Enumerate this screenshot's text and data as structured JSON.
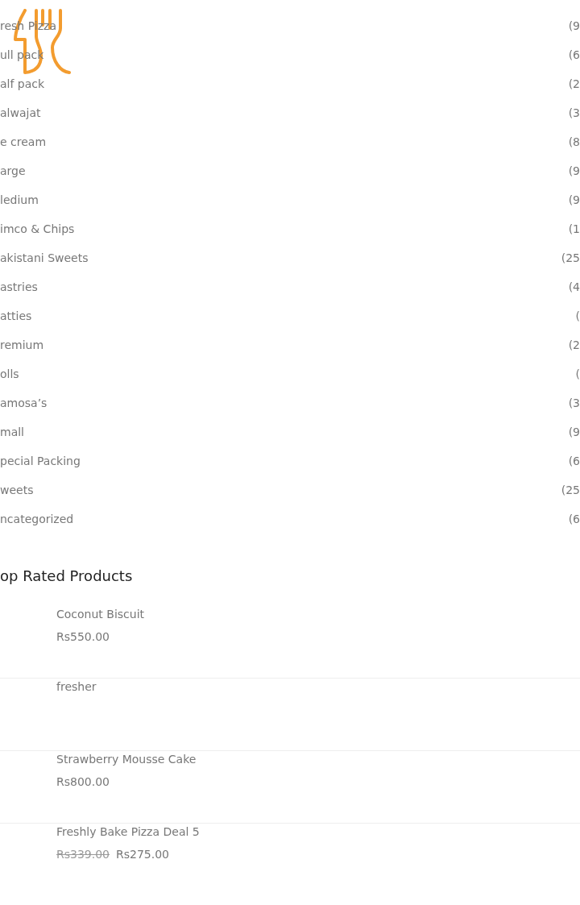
{
  "categories": [
    {
      "label": "resh Pizza",
      "count": "(9"
    },
    {
      "label": "ull pack",
      "count": "(6"
    },
    {
      "label": "alf pack",
      "count": "(2"
    },
    {
      "label": "alwajat",
      "count": "(3"
    },
    {
      "label": "e cream",
      "count": "(8"
    },
    {
      "label": "arge",
      "count": "(9"
    },
    {
      "label": "ledium",
      "count": "(9"
    },
    {
      "label": "imco & Chips",
      "count": "(1"
    },
    {
      "label": "akistani Sweets",
      "count": "(25"
    },
    {
      "label": "astries",
      "count": "(4"
    },
    {
      "label": "atties",
      "count": "("
    },
    {
      "label": "remium",
      "count": "(2"
    },
    {
      "label": "olls",
      "count": "("
    },
    {
      "label": "amosa’s",
      "count": "(3"
    },
    {
      "label": "mall",
      "count": "(9"
    },
    {
      "label": "pecial Packing",
      "count": "(6"
    },
    {
      "label": "weets",
      "count": "(25"
    },
    {
      "label": "ncategorized",
      "count": "(6"
    }
  ],
  "top_rated": {
    "title": "op Rated Products",
    "products": [
      {
        "name": "Coconut Biscuit",
        "price": "Rs550.00"
      },
      {
        "name": "fresher"
      },
      {
        "name": "Strawberry Mousse Cake",
        "price": "Rs800.00"
      },
      {
        "name": "Freshly Bake Pizza Deal 5",
        "old_price": "Rs339.00",
        "price": "Rs275.00"
      }
    ]
  }
}
